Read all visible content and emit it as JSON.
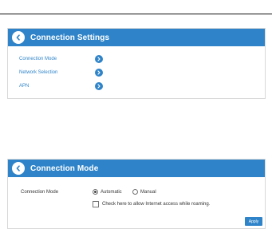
{
  "settings_panel": {
    "title": "Connection Settings",
    "items": [
      {
        "label": "Connection Mode"
      },
      {
        "label": "Network Selection"
      },
      {
        "label": "APN"
      }
    ]
  },
  "mode_panel": {
    "title": "Connection Mode",
    "field_label": "Connection Mode",
    "options": [
      {
        "label": "Automatic",
        "selected": true
      },
      {
        "label": "Manual",
        "selected": false
      }
    ],
    "roaming_checkbox": {
      "label": "Check here to allow Internet access while roaming.",
      "checked": false
    },
    "apply_label": "Apply"
  },
  "colors": {
    "accent": "#2f84c9",
    "text": "#333333",
    "border": "#d8d8d8"
  },
  "icons": {
    "back": "chevron-left-icon",
    "go": "chevron-right-icon"
  }
}
